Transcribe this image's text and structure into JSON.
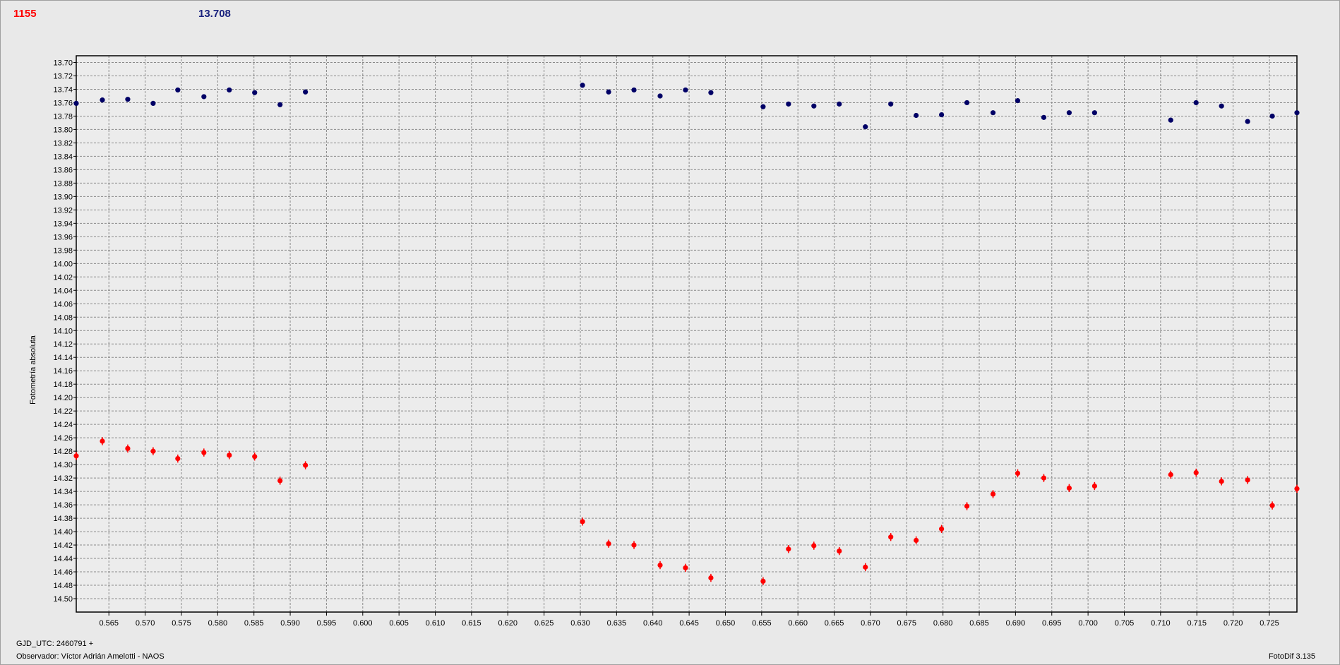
{
  "header": {
    "left_value": "1155",
    "left_color": "#ff0000",
    "right_value": "13.708",
    "right_color": "#1a237e"
  },
  "footer": {
    "gjd": "GJD_UTC: 2460791 +",
    "observer": "Observador: Víctor Adrián Amelotti - NAOS",
    "version": "FotoDif 3.135"
  },
  "chart_data": {
    "type": "scatter",
    "ylabel": "Fotometría absoluta",
    "ylim": [
      13.69,
      14.52
    ],
    "y_inverted": true,
    "xlim": [
      0.5605,
      0.7288
    ],
    "grid": true,
    "x_ticks": [
      "0.565",
      "0.570",
      "0.575",
      "0.580",
      "0.585",
      "0.590",
      "0.595",
      "0.600",
      "0.605",
      "0.610",
      "0.615",
      "0.620",
      "0.625",
      "0.630",
      "0.635",
      "0.640",
      "0.645",
      "0.650",
      "0.655",
      "0.660",
      "0.665",
      "0.670",
      "0.675",
      "0.680",
      "0.685",
      "0.690",
      "0.695",
      "0.700",
      "0.705",
      "0.710",
      "0.715",
      "0.720",
      "0.725"
    ],
    "y_ticks": [
      "13.70",
      "13.72",
      "13.74",
      "13.76",
      "13.78",
      "13.80",
      "13.82",
      "13.84",
      "13.86",
      "13.88",
      "13.90",
      "13.92",
      "13.94",
      "13.96",
      "13.98",
      "14.00",
      "14.02",
      "14.04",
      "14.06",
      "14.08",
      "14.10",
      "14.12",
      "14.14",
      "14.16",
      "14.18",
      "14.20",
      "14.22",
      "14.24",
      "14.26",
      "14.28",
      "14.30",
      "14.32",
      "14.34",
      "14.36",
      "14.38",
      "14.40",
      "14.42",
      "14.44",
      "14.46",
      "14.48",
      "14.50"
    ],
    "series": [
      {
        "color": "#000066",
        "x": [
          0.5605,
          0.5641,
          0.5676,
          0.5711,
          0.5745,
          0.5781,
          0.5816,
          0.5851,
          0.5886,
          0.5921,
          0.6303,
          0.6339,
          0.6374,
          0.641,
          0.6445,
          0.648,
          0.6552,
          0.6587,
          0.6622,
          0.6657,
          0.6693,
          0.6728,
          0.6763,
          0.6798,
          0.6833,
          0.6869,
          0.6903,
          0.6939,
          0.6974,
          0.7009,
          0.7114,
          0.7149,
          0.7184,
          0.722,
          0.7254,
          0.7288
        ],
        "y": [
          13.761,
          13.756,
          13.755,
          13.761,
          13.741,
          13.751,
          13.741,
          13.745,
          13.763,
          13.744,
          13.734,
          13.744,
          13.741,
          13.75,
          13.741,
          13.745,
          13.766,
          13.762,
          13.765,
          13.762,
          13.796,
          13.762,
          13.779,
          13.778,
          13.76,
          13.775,
          13.757,
          13.782,
          13.775,
          13.775,
          13.786,
          13.76,
          13.765,
          13.788,
          13.78,
          13.775
        ],
        "err": [
          0.003,
          0.003,
          0.003,
          0.003,
          0.003,
          0.003,
          0.003,
          0.003,
          0.003,
          0.003,
          0.003,
          0.003,
          0.003,
          0.003,
          0.003,
          0.003,
          0.003,
          0.003,
          0.003,
          0.003,
          0.003,
          0.003,
          0.003,
          0.003,
          0.003,
          0.003,
          0.003,
          0.003,
          0.003,
          0.003,
          0.003,
          0.003,
          0.003,
          0.003,
          0.003,
          0.003
        ]
      },
      {
        "color": "#ff0000",
        "x": [
          0.5605,
          0.5641,
          0.5676,
          0.5711,
          0.5745,
          0.5781,
          0.5816,
          0.5851,
          0.5886,
          0.5921,
          0.6303,
          0.6339,
          0.6374,
          0.641,
          0.6445,
          0.648,
          0.6552,
          0.6587,
          0.6622,
          0.6657,
          0.6693,
          0.6728,
          0.6763,
          0.6798,
          0.6833,
          0.6869,
          0.6903,
          0.6939,
          0.6974,
          0.7009,
          0.7114,
          0.7149,
          0.7184,
          0.722,
          0.7254,
          0.7288
        ],
        "y": [
          14.287,
          14.265,
          14.276,
          14.28,
          14.291,
          14.282,
          14.286,
          14.288,
          14.324,
          14.301,
          14.385,
          14.418,
          14.42,
          14.45,
          14.454,
          14.469,
          14.474,
          14.426,
          14.421,
          14.429,
          14.453,
          14.408,
          14.413,
          14.396,
          14.362,
          14.344,
          14.313,
          14.32,
          14.335,
          14.332,
          14.315,
          14.312,
          14.325,
          14.323,
          14.361,
          14.336
        ],
        "err": [
          0.006,
          0.006,
          0.006,
          0.006,
          0.006,
          0.006,
          0.006,
          0.006,
          0.006,
          0.006,
          0.006,
          0.006,
          0.006,
          0.006,
          0.006,
          0.006,
          0.006,
          0.006,
          0.006,
          0.006,
          0.006,
          0.006,
          0.006,
          0.006,
          0.006,
          0.006,
          0.006,
          0.006,
          0.006,
          0.006,
          0.006,
          0.006,
          0.006,
          0.006,
          0.006,
          0.006
        ]
      }
    ]
  }
}
